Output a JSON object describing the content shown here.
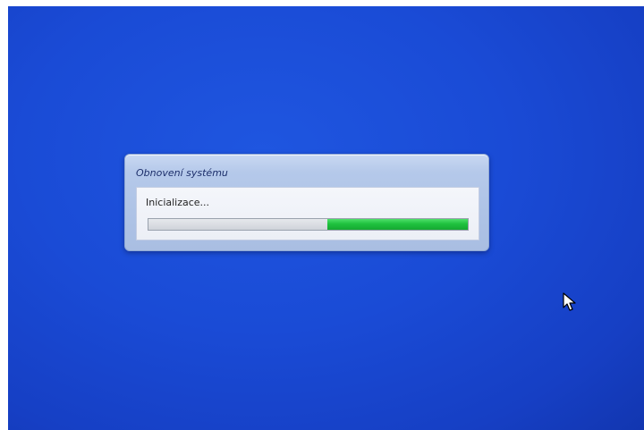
{
  "dialog": {
    "title": "Obnovení systému",
    "status": "Inicializace..."
  },
  "progress": {
    "style": "marquee",
    "fill_start": 0.56,
    "fill_end": 1.0
  },
  "colors": {
    "desktop_background": "#1a4bd6",
    "progress_fill": "#1fc23f"
  },
  "icons": {
    "cursor": "mouse-pointer-icon"
  }
}
